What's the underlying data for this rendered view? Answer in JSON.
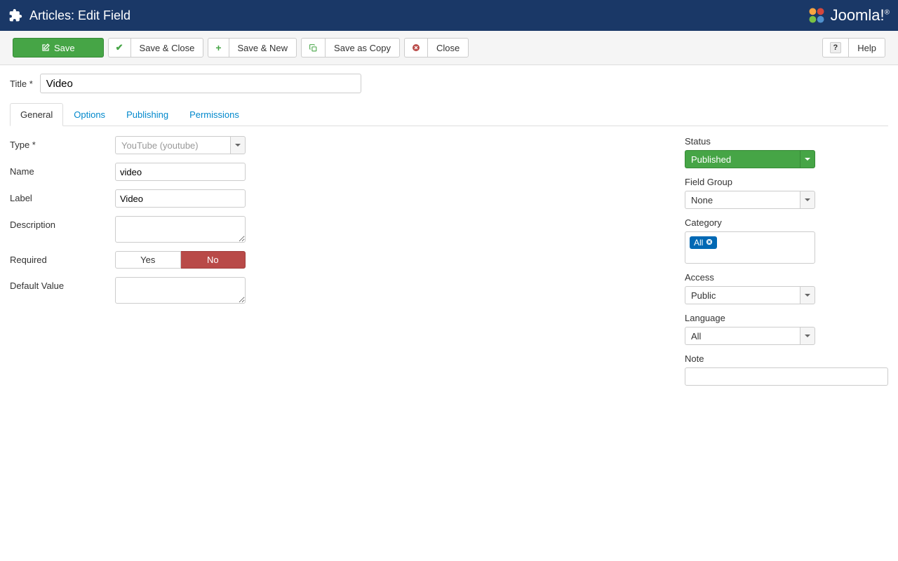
{
  "header": {
    "title": "Articles: Edit Field",
    "brand": "Joomla!"
  },
  "toolbar": {
    "save": "Save",
    "save_close": "Save & Close",
    "save_new": "Save & New",
    "save_copy": "Save as Copy",
    "close": "Close",
    "help": "Help"
  },
  "title": {
    "label": "Title *",
    "value": "Video"
  },
  "tabs": [
    "General",
    "Options",
    "Publishing",
    "Permissions"
  ],
  "form": {
    "type": {
      "label": "Type *",
      "value": "YouTube (youtube)"
    },
    "name": {
      "label": "Name",
      "value": "video"
    },
    "label_field": {
      "label": "Label",
      "value": "Video"
    },
    "description": {
      "label": "Description",
      "value": ""
    },
    "required": {
      "label": "Required",
      "yes": "Yes",
      "no": "No"
    },
    "default_value": {
      "label": "Default Value",
      "value": ""
    }
  },
  "side": {
    "status": {
      "label": "Status",
      "value": "Published"
    },
    "field_group": {
      "label": "Field Group",
      "value": "None"
    },
    "category": {
      "label": "Category",
      "tag": "All"
    },
    "access": {
      "label": "Access",
      "value": "Public"
    },
    "language": {
      "label": "Language",
      "value": "All"
    },
    "note": {
      "label": "Note",
      "value": ""
    }
  }
}
